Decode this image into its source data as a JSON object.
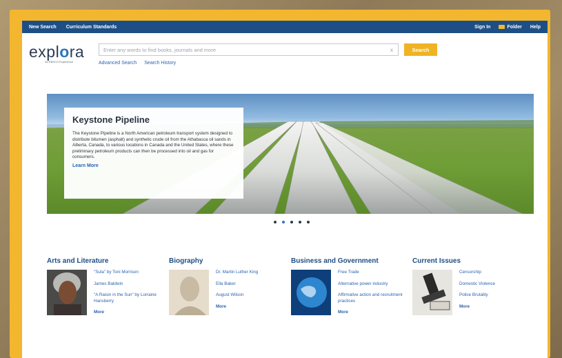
{
  "topbar": {
    "left_links": [
      "New Search",
      "Curriculum Standards"
    ],
    "sign_in": "Sign In",
    "folder": "Folder",
    "help": "Help"
  },
  "logo": {
    "pre": "expl",
    "o": "o",
    "post": "ra",
    "sub": "An EBSCO Experience"
  },
  "search": {
    "placeholder": "Enter any words to find books, journals and more",
    "clear": "x",
    "button": "Search"
  },
  "sublinks": {
    "advanced": "Advanced Search",
    "history": "Search History"
  },
  "hero": {
    "title": "Keystone Pipeline",
    "text": "The Keystone Pipeline is a North American petroleum transport system designed to distribute bitumen (asphalt) and synthetic crude oil from the Athabasca oil sands in Alberta, Canada, to various locations in Canada and the United States, where these preliminary petroleum products can then be processed into oil and gas for consumers.",
    "link": "Learn More",
    "prev": "‹",
    "next": "›",
    "dots_total": 5,
    "dots_active_index": 1
  },
  "categories": [
    {
      "title": "Arts and Literature",
      "links": [
        "\"Sula\" by Toni Morrison",
        "James Baldwin",
        "\"A Raisin in the Sun\" by Lorraine Hansberry"
      ],
      "more": "More"
    },
    {
      "title": "Biography",
      "links": [
        "Dr. Martin Luther King",
        "Ella Baker",
        "August Wilson"
      ],
      "more": "More"
    },
    {
      "title": "Business and Government",
      "links": [
        "Free Trade",
        "Alternative power industry",
        "Affirmative action and recruitment practices"
      ],
      "more": "More"
    },
    {
      "title": "Current Issues",
      "links": [
        "Censorship",
        "Domestic Violence",
        "Police Brutality"
      ],
      "more": "More"
    }
  ],
  "colors": {
    "topbar": "#1d4f86",
    "accent": "#f0b323",
    "link": "#2b62b0",
    "frame": "#f3b62f"
  }
}
